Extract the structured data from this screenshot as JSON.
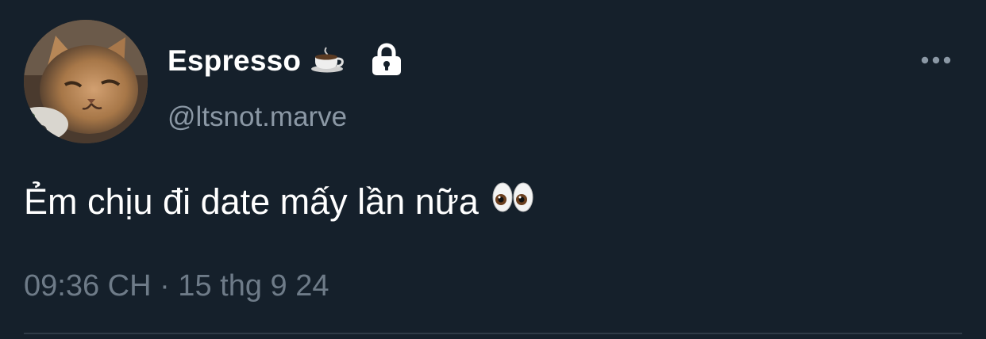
{
  "author": {
    "display_name": "Espresso",
    "handle": "@ltsnot.marve",
    "name_emoji": "coffee-cup-icon",
    "protected": true
  },
  "tweet": {
    "text": "Ẻm chịu đi date mấy lần nữa",
    "trailing_emoji": "eyes-icon",
    "timestamp": "09:36 CH · 15 thg 9 24"
  },
  "colors": {
    "background": "#15202b",
    "primary_text": "#ffffff",
    "secondary_text": "#8b98a5",
    "timestamp_text": "#6e7b88",
    "divider": "#2f3b47"
  },
  "icons": {
    "more": "more-horizontal-icon",
    "lock": "lock-icon"
  }
}
